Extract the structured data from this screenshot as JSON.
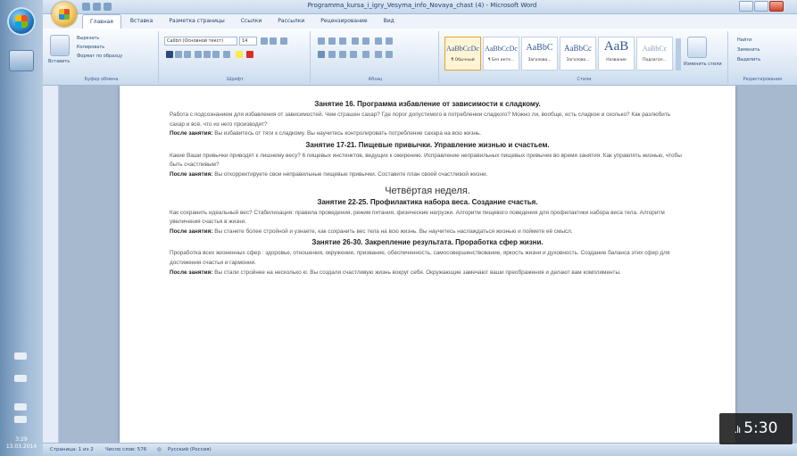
{
  "window": {
    "title": "Programma_kursa_i_igry_Vesyma_info_Novaya_chast (4) - Microsoft Word"
  },
  "ribbon": {
    "tabs": [
      "Главная",
      "Вставка",
      "Разметка страницы",
      "Ссылки",
      "Рассылки",
      "Рецензирование",
      "Вид"
    ],
    "clipboard_label": "Буфер обмена",
    "paste_label": "Вставить",
    "cut_label": "Вырезать",
    "copy_label": "Копировать",
    "format_label": "Формат по образцу",
    "font_label": "Шрифт",
    "paragraph_label": "Абзац",
    "styles_label": "Стили",
    "editing_label": "Редактирование",
    "font_name": "Calibri (Основной текст)",
    "font_size": "14",
    "styles": [
      {
        "sample": "AaBbCcDc",
        "name": "¶ Обычный"
      },
      {
        "sample": "AaBbCcDc",
        "name": "¶ Без инте..."
      },
      {
        "sample": "AaBbC",
        "name": "Заголово..."
      },
      {
        "sample": "AaBbCc",
        "name": "Заголово..."
      },
      {
        "sample": "AaB",
        "name": "Название"
      },
      {
        "sample": "AaBbCc",
        "name": "Подзагол..."
      }
    ],
    "change_styles_label": "Изменить стили",
    "find_label": "Найти",
    "replace_label": "Заменить",
    "select_label": "Выделить"
  },
  "document": {
    "h1": "Занятие 16. Программа избавление от зависимости к сладкому.",
    "p1": "Работа с подсознанием для избавления от зависимостей. Чем страшен сахар? Где порог допустимого в потреблении сладкого? Можно ли, вообще, есть сладкое и сколько? Как разлюбить сахар и всё, что из него производят?",
    "p1_after_lead": "После занятия:",
    "p1_after": " Вы избавитесь от тяги к сладкому. Вы научитесь контролировать потребление сахара на всю жизнь.",
    "h2": "Занятие 17-21. Пищевые привычки. Управление жизнью и счастьем.",
    "p2": "Какие Ваши привычки приводят к лишнему весу? 6 пищевых инстинктов, ведущих к ожирению. Исправление неправильных пищевых привычек во время занятия. Как управлять жизнью, чтобы быть счастливым?",
    "p2_after_lead": "После занятия:",
    "p2_after": " Вы откорректируете свои неправильные пищевые привычки. Составите план своей счастливой жизни.",
    "week": "Четвёртая неделя.",
    "h3": "Занятие 22-25. Профилактика набора веса. Создание счастья.",
    "p3": "Как сохранить идеальный вес? Стабилизация: правила проведения, режим питания, физические нагрузки. Алгоритм пищевого поведения для профилактики набора веса тела. Алгоритм увеличения счастья в жизни.",
    "p3_after_lead": "После занятия:",
    "p3_after": " Вы станете более стройной и узнаете, как сохранить вес тела на всю жизнь. Вы научитесь наслаждаться жизнью и поймете её смысл.",
    "h4": "Занятие 26-30. Закрепление результата. Проработка сфер жизни.",
    "p4": "Проработка всех жизненных сфер : здоровье, отношения, окружение, призвание, обеспеченность, самосовершенствование, яркость жизни и духовность. Создание баланса этих сфер для достижения счастья и гармонии.",
    "p4_after_lead": "После занятия:",
    "p4_after": " Вы стали стройнее на несколько кг. Вы создали счастливую жизнь вокруг себя. Окружающие замечают ваши преображения и делают вам комплименты."
  },
  "statusbar": {
    "page": "Страница: 1 из 2",
    "words": "Число слов: 576",
    "language": "Русский (Россия)"
  },
  "taskbar": {
    "time": "3:29",
    "date": "13.03.2014"
  },
  "video": {
    "duration": "5:30",
    "bars_icon": ".lı"
  }
}
